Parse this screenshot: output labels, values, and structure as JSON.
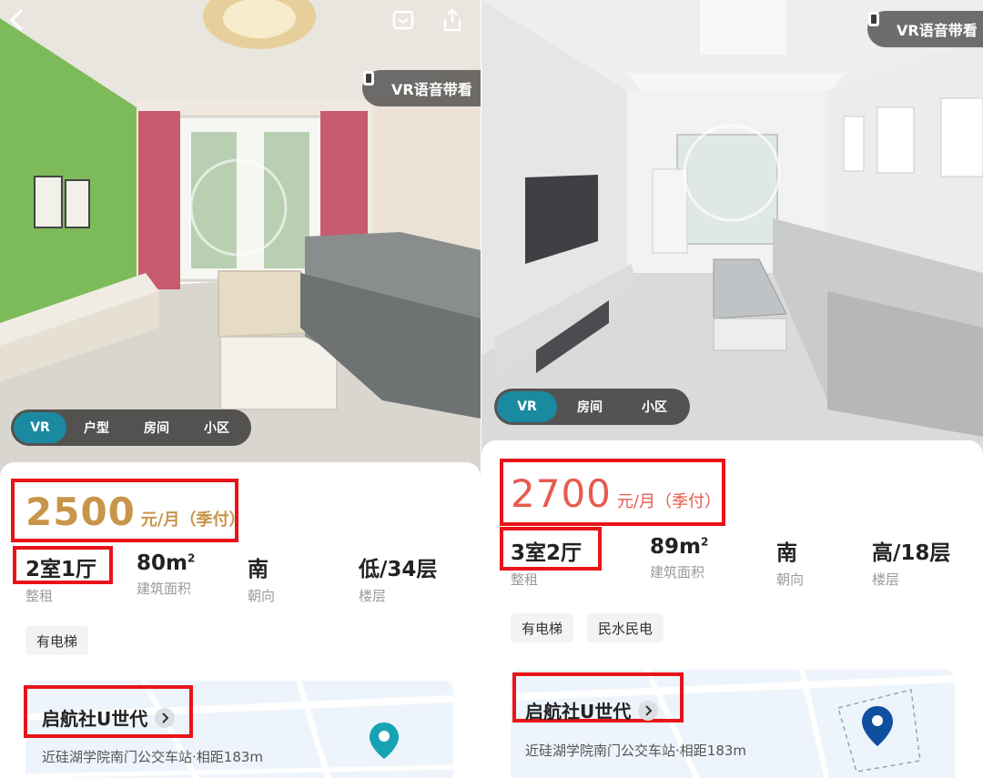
{
  "colors": {
    "highlight_box": "#e8141a",
    "price_left": "#c8954a",
    "price_right": "#e85a4f",
    "tab_active": "#1a8aa0",
    "pin_left": "#16a4b4",
    "pin_right": "#0e4fa0"
  },
  "icons": {
    "back": "chevron-left-icon",
    "bookmark": "bookmark-icon",
    "share": "share-icon",
    "vr": "vr-cube-icon",
    "arrow": "chevron-right-icon",
    "location": "map-pin-icon"
  },
  "left": {
    "vr_guide": "VR语音带看",
    "tabs": [
      {
        "label": "VR",
        "active": true
      },
      {
        "label": "户型",
        "active": false
      },
      {
        "label": "房间",
        "active": false
      },
      {
        "label": "小区",
        "active": false
      }
    ],
    "price": {
      "amount": "2500",
      "unit": "元/月（季付）"
    },
    "stats": [
      {
        "value": "2室1厅",
        "label": "整租"
      },
      {
        "value": "80m",
        "sup": "2",
        "label": "建筑面积"
      },
      {
        "value": "南",
        "label": "朝向"
      },
      {
        "value": "低/34层",
        "label": "楼层"
      }
    ],
    "tags": [
      "有电梯"
    ],
    "community": {
      "name": "启航社U世代",
      "transit": "近硅湖学院南门公交车站·相距183m"
    }
  },
  "right": {
    "vr_guide": "VR语音带看",
    "tabs": [
      {
        "label": "VR",
        "active": true
      },
      {
        "label": "房间",
        "active": false
      },
      {
        "label": "小区",
        "active": false
      }
    ],
    "price": {
      "amount": "2700",
      "unit": "元/月（季付）"
    },
    "stats": [
      {
        "value": "3室2厅",
        "label": "整租"
      },
      {
        "value": "89m",
        "sup": "2",
        "label": "建筑面积"
      },
      {
        "value": "南",
        "label": "朝向"
      },
      {
        "value": "高/18层",
        "label": "楼层"
      }
    ],
    "tags": [
      "有电梯",
      "民水民电"
    ],
    "community": {
      "name": "启航社U世代",
      "transit": "近硅湖学院南门公交车站·相距183m"
    }
  }
}
